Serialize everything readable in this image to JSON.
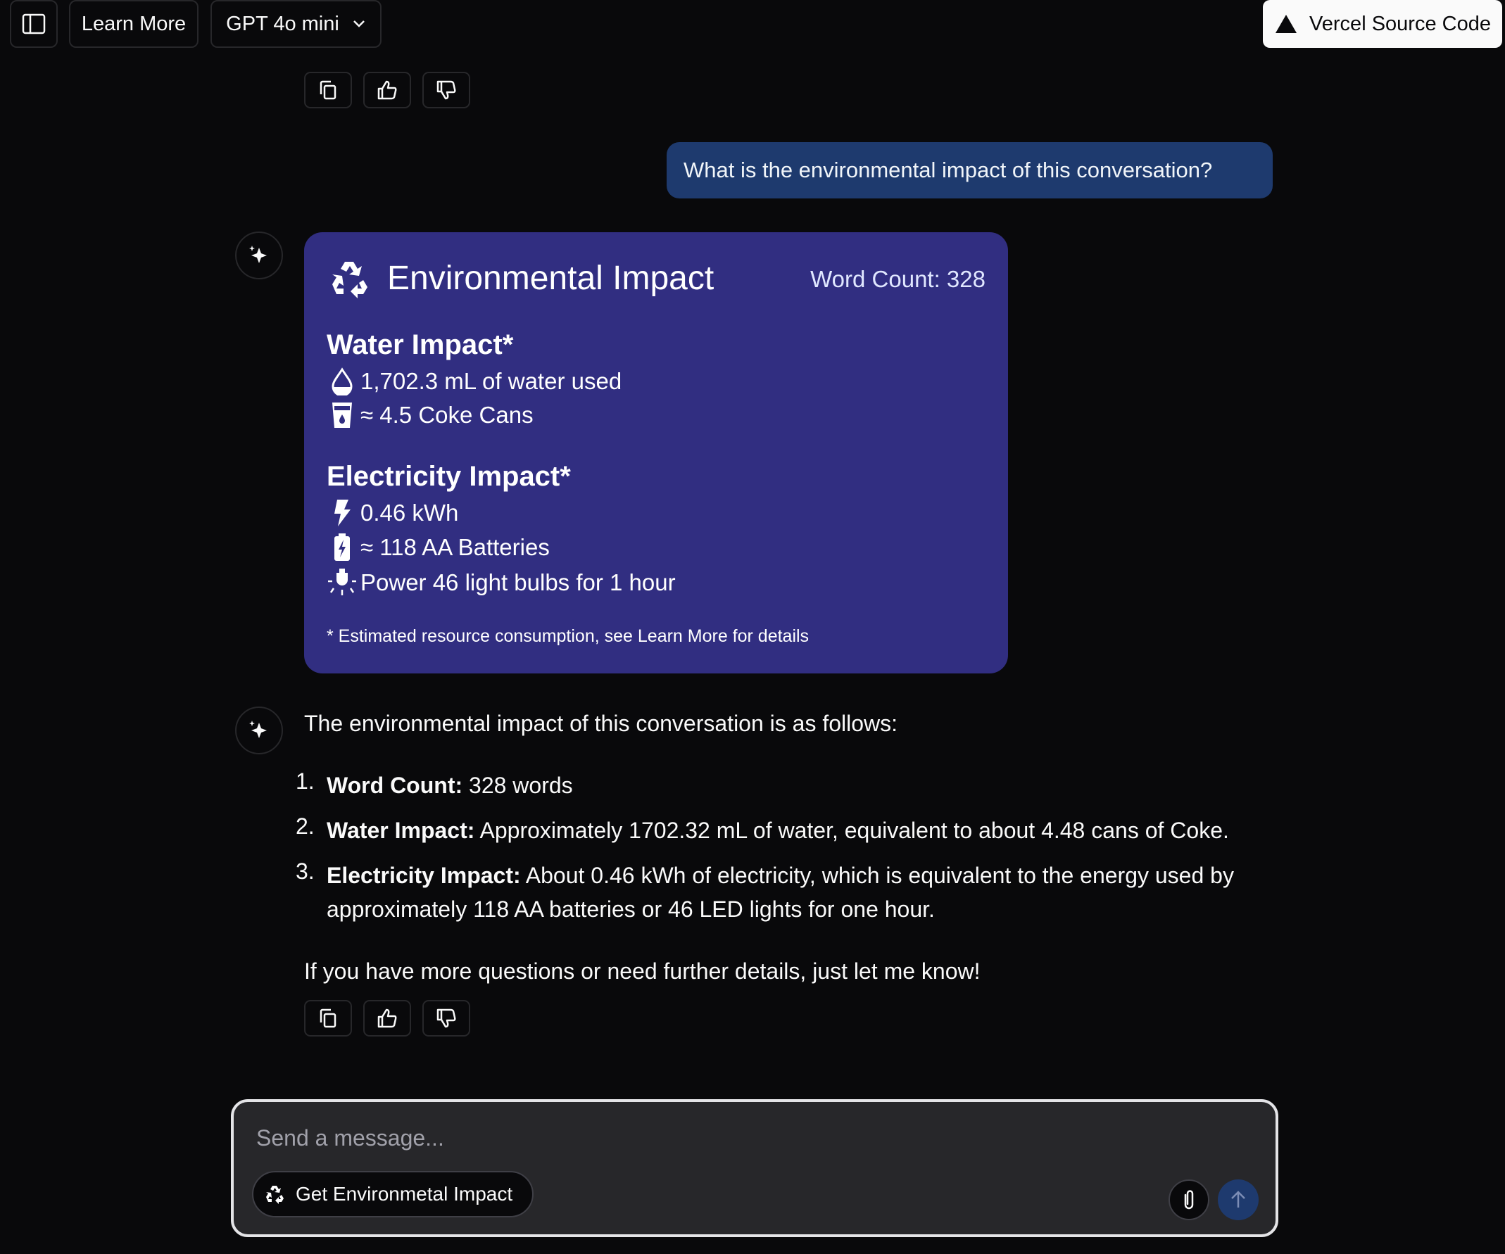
{
  "header": {
    "sidebar_toggle_icon": "sidebar-icon",
    "learn_more_label": "Learn More",
    "model_label": "GPT 4o mini",
    "vercel_label": "Vercel Source Code"
  },
  "messages": {
    "user_text": "What is the environmental impact of this conversation?",
    "card": {
      "title": "Environmental Impact",
      "word_count": "Word Count: 328",
      "water_heading": "Water Impact*",
      "water_used": "1,702.3 mL of water used",
      "coke_cans": "≈ 4.5 Coke Cans",
      "electricity_heading": "Electricity Impact*",
      "kwh": "0.46 kWh",
      "batteries": "≈ 118 AA Batteries",
      "bulbs": "Power 46 light bulbs for 1 hour",
      "footnote": "* Estimated resource consumption, see Learn More for details"
    },
    "response": {
      "intro": "The environmental impact of this conversation is as follows:",
      "items": [
        {
          "num": "1.",
          "label": "Word Count:",
          "text": " 328 words"
        },
        {
          "num": "2.",
          "label": "Water Impact:",
          "text": " Approximately 1702.32 mL of water, equivalent to about 4.48 cans of Coke."
        },
        {
          "num": "3.",
          "label": "Electricity Impact:",
          "text": " About 0.46 kWh of electricity, which is equivalent to the energy used by approximately 118 AA batteries or 46 LED lights for one hour."
        }
      ],
      "outro": "If you have more questions or need further details, just let me know!"
    }
  },
  "composer": {
    "placeholder": "Send a message...",
    "chip_label": "Get Environmetal Impact"
  },
  "colors": {
    "background": "#09090b",
    "user_bubble": "#1e3a6e",
    "card": "#312e81"
  }
}
